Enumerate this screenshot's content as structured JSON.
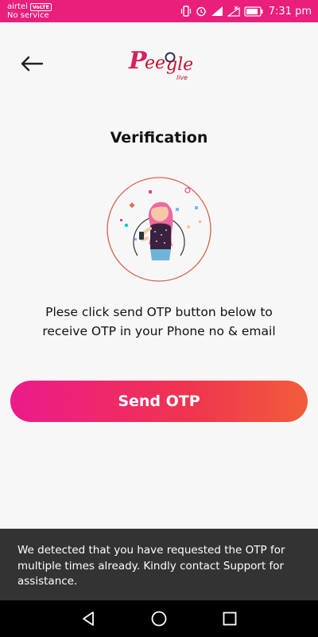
{
  "status_bar": {
    "carrier": "airtel",
    "network_badge": "VoLTE",
    "service": "No service",
    "time": "7:31 pm",
    "icons": [
      "vibrate-icon",
      "alarm-icon",
      "signal-icon",
      "no-signal-icon",
      "battery-icon"
    ]
  },
  "header": {
    "back_icon": "arrow-left-icon",
    "logo_text": "Peeple",
    "logo_subtext": "live"
  },
  "page": {
    "title": "Verification",
    "instruction": "Plese click  send OTP button below to receive OTP in your Phone no & email",
    "send_otp_label": "Send OTP"
  },
  "snackbar": {
    "message": "We detected that you have requested the OTP for multiple times already. Kindly contact Support for assistance."
  },
  "nav_bar": {
    "icons": [
      "back-triangle-icon",
      "home-circle-icon",
      "recents-square-icon"
    ]
  },
  "colors": {
    "status_bar": "#ea1e7b",
    "button_gradient_start": "#ec1a8b",
    "button_gradient_end": "#f25c39",
    "snackbar_bg": "#333333",
    "illustration_circle": "#d9644a"
  }
}
